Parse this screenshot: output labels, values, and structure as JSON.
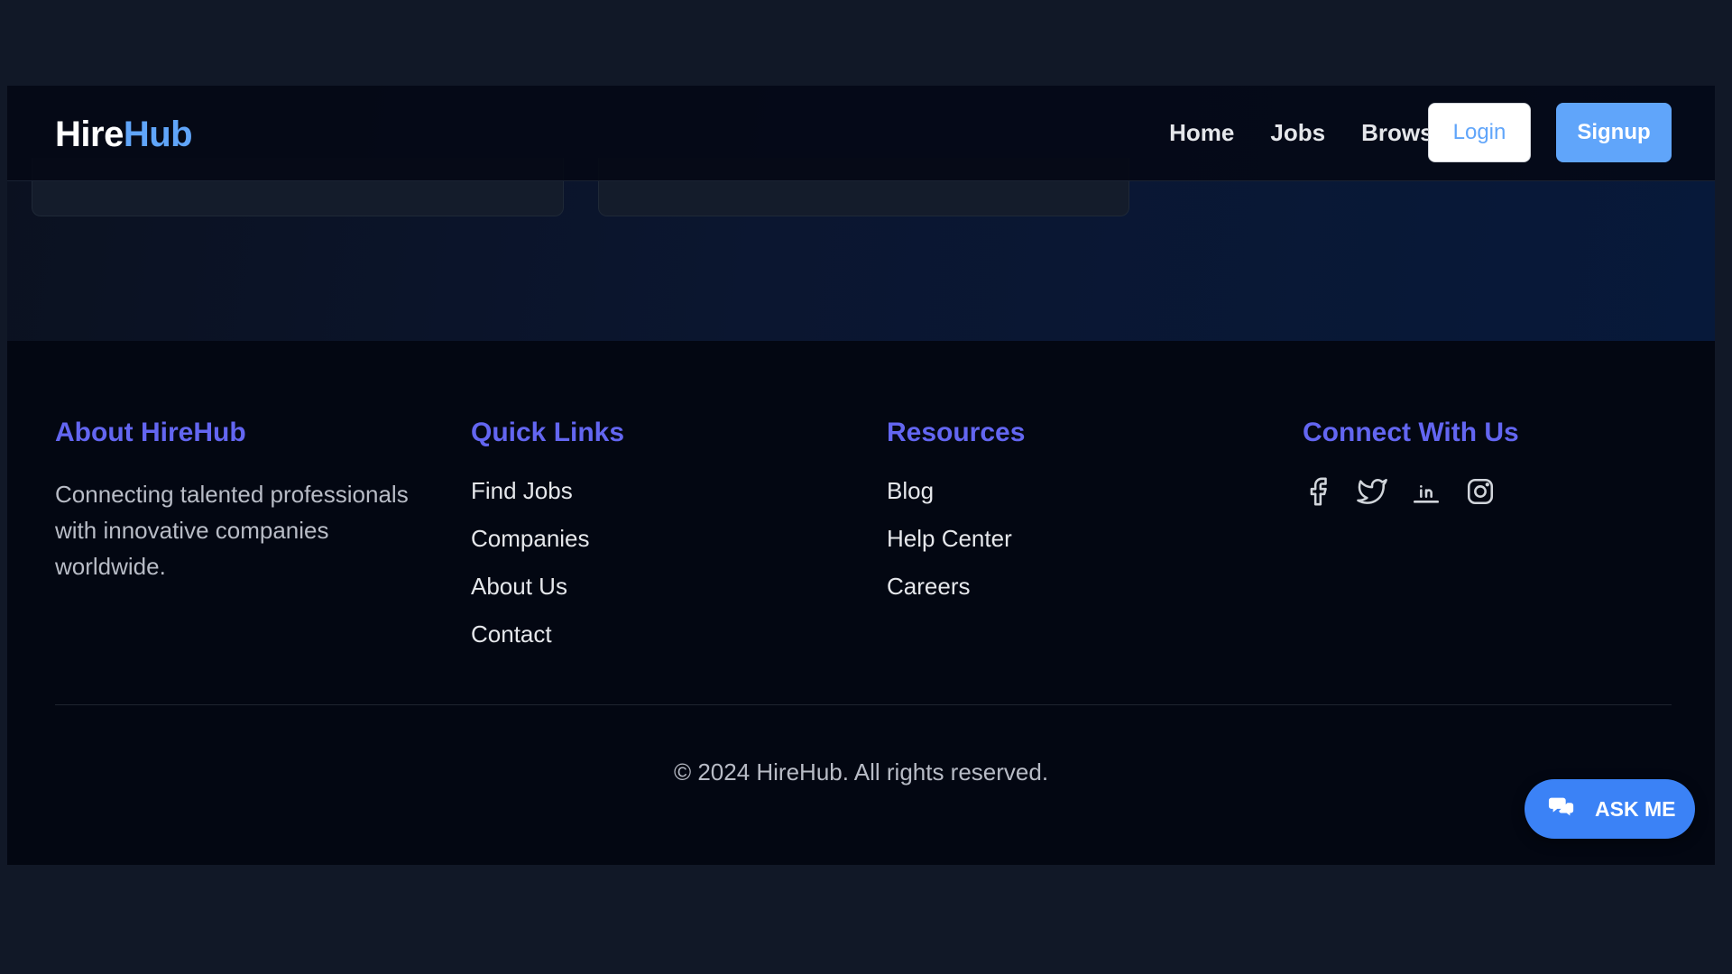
{
  "brand": {
    "part1": "Hire",
    "part2": "Hub"
  },
  "nav": {
    "links": [
      "Home",
      "Jobs",
      "Browse"
    ],
    "login_label": "Login",
    "signup_label": "Signup"
  },
  "footer": {
    "about": {
      "title": "About HireHub",
      "text": "Connecting talented professionals with innovative companies worldwide."
    },
    "quick_links": {
      "title": "Quick Links",
      "items": [
        "Find Jobs",
        "Companies",
        "About Us",
        "Contact"
      ]
    },
    "resources": {
      "title": "Resources",
      "items": [
        "Blog",
        "Help Center",
        "Careers"
      ]
    },
    "connect": {
      "title": "Connect With Us",
      "icons": [
        "facebook-icon",
        "twitter-icon",
        "linkedin-icon",
        "instagram-icon"
      ]
    },
    "copyright": "© 2024 HireHub. All rights reserved."
  },
  "chat": {
    "label": "ASK ME",
    "icon": "chat-bubbles-icon"
  },
  "colors": {
    "accent": "#60a5fa",
    "heading": "#6366f1",
    "chat_button": "#3b82f6",
    "background": "#111827",
    "footer_bg": "#030712"
  }
}
